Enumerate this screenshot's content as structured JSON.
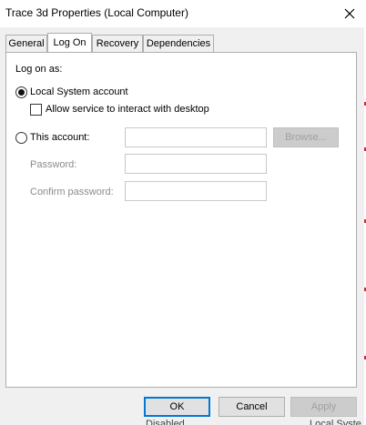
{
  "window": {
    "title": "Trace 3d Properties (Local Computer)"
  },
  "tabs": [
    {
      "label": "General",
      "active": false
    },
    {
      "label": "Log On",
      "active": true
    },
    {
      "label": "Recovery",
      "active": false
    },
    {
      "label": "Dependencies",
      "active": false
    }
  ],
  "logon": {
    "heading": "Log on as:",
    "local_system_label": "Local System account",
    "local_system_selected": true,
    "interact_desktop_label": "Allow service to interact with desktop",
    "interact_desktop_checked": false,
    "this_account_label": "This account:",
    "this_account_selected": false,
    "account_value": "",
    "browse_label": "Browse...",
    "password_label": "Password:",
    "password_value": "",
    "confirm_label": "Confirm password:",
    "confirm_value": ""
  },
  "buttons": {
    "ok": "OK",
    "cancel": "Cancel",
    "apply": "Apply"
  },
  "background_text": {
    "left": "Disabled",
    "right": "Local Syste"
  },
  "colors": {
    "accent": "#0078d7",
    "panel": "#ffffff",
    "window": "#f0f0f0"
  }
}
